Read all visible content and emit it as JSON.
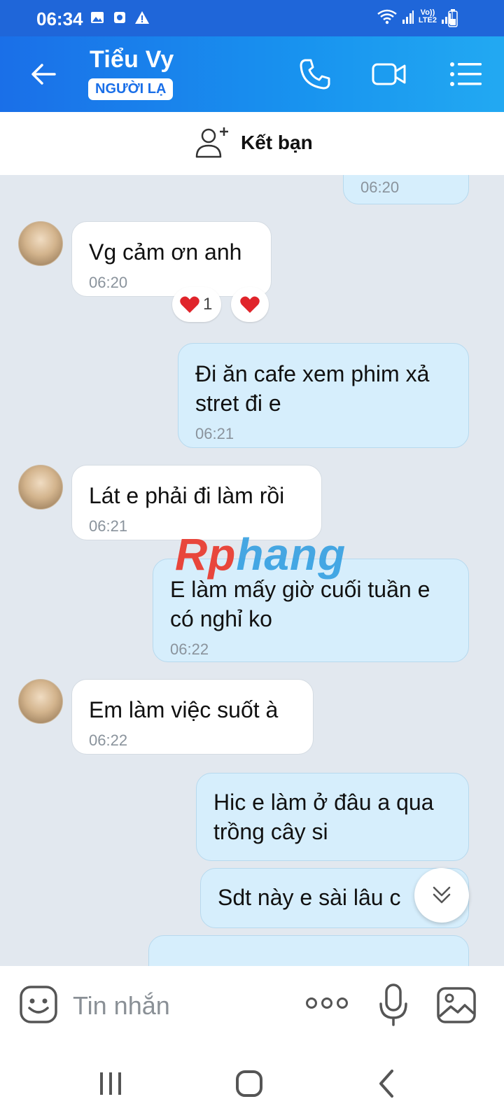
{
  "status_bar": {
    "time": "06:34",
    "carrier_line1": "Vo))",
    "carrier_line2": "LTE2"
  },
  "header": {
    "title": "Tiểu Vy",
    "tag": "NGƯỜI LẠ"
  },
  "friend_bar": {
    "label": "Kết bạn"
  },
  "messages": [
    {
      "direction": "out",
      "text": "",
      "time": "06:20"
    },
    {
      "direction": "in",
      "text": "Vg cảm ơn anh",
      "time": "06:20",
      "reactions": [
        {
          "emoji": "heart",
          "count": "1"
        },
        {
          "emoji": "heart"
        }
      ]
    },
    {
      "direction": "out",
      "text": "Đi ăn cafe xem phim xả stret đi e",
      "time": "06:21"
    },
    {
      "direction": "in",
      "text": "Lát e phải đi làm rồi",
      "time": "06:21"
    },
    {
      "direction": "out",
      "text": "E làm mấy giờ cuối tuần e có nghỉ ko",
      "time": "06:22"
    },
    {
      "direction": "in",
      "text": "Em làm việc suốt à",
      "time": "06:22"
    },
    {
      "direction": "out",
      "text": "Hic e làm ở đâu a qua trồng cây si",
      "time": ""
    },
    {
      "direction": "out",
      "text": "Sdt này e sài lâu c",
      "time": ""
    }
  ],
  "watermark": {
    "part1": "Rp",
    "part2": "hang"
  },
  "input_bar": {
    "placeholder": "Tin nhắn"
  },
  "colors": {
    "header_start": "#1a6fe8",
    "header_end": "#22a9f2",
    "outgoing_bubble": "#d6eefc",
    "incoming_bubble": "#ffffff",
    "chat_bg": "#e2e8ef"
  },
  "icons": [
    "back-arrow-icon",
    "phone-icon",
    "video-call-icon",
    "menu-list-icon",
    "add-friend-icon",
    "heart-icon",
    "emoji-icon",
    "more-icon",
    "microphone-icon",
    "image-icon",
    "double-chevron-down-icon",
    "recent-apps-icon",
    "home-icon",
    "nav-back-icon"
  ]
}
